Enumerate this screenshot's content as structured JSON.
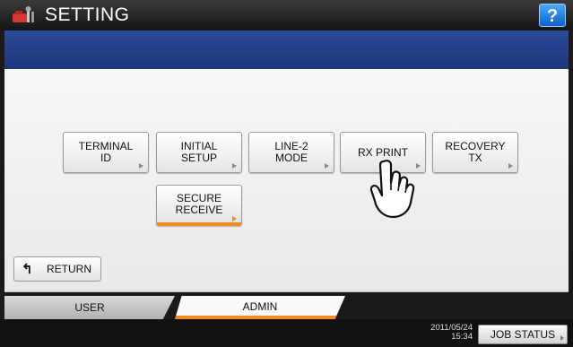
{
  "header": {
    "title": "SETTING",
    "help_label": "?",
    "app_icon": "setting-tools-icon"
  },
  "buttons": [
    {
      "id": "terminal-id",
      "label": "TERMINAL\nID",
      "selected": false
    },
    {
      "id": "initial-setup",
      "label": "INITIAL\nSETUP",
      "selected": false
    },
    {
      "id": "line2-mode",
      "label": "LINE-2\nMODE",
      "selected": false
    },
    {
      "id": "rx-print",
      "label": "RX PRINT",
      "selected": false
    },
    {
      "id": "recovery-tx",
      "label": "RECOVERY\nTX",
      "selected": false
    },
    {
      "id": "secure-receive",
      "label": "SECURE\nRECEIVE",
      "selected": true
    }
  ],
  "return_label": "RETURN",
  "tabs": {
    "user": "USER",
    "admin": "ADMIN",
    "active": "admin"
  },
  "status": {
    "date": "2011/05/24",
    "time": "15:34",
    "job_status": "JOB STATUS"
  },
  "colors": {
    "accent": "#f08a1c",
    "band": "#1d357b",
    "help": "#0c62c9"
  }
}
